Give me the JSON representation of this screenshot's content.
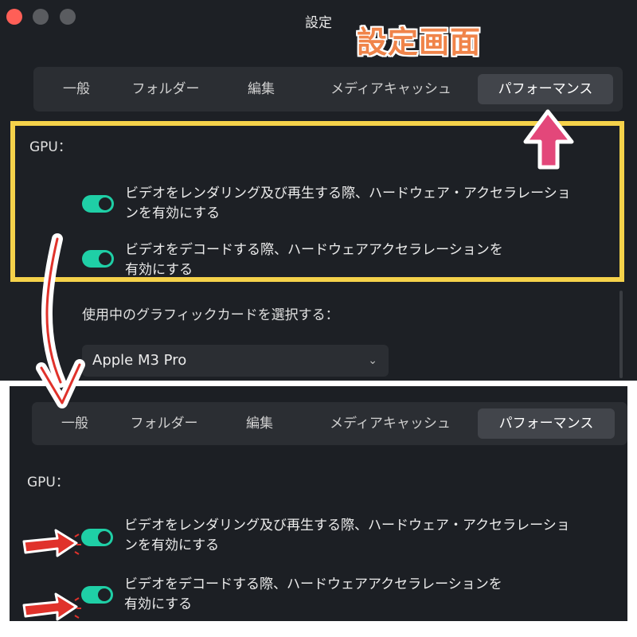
{
  "window": {
    "title": "設定"
  },
  "annotation": {
    "title": "設定画面"
  },
  "tabs": [
    "一般",
    "フォルダー",
    "編集",
    "メディアキャッシュ",
    "パフォーマンス"
  ],
  "active_tab": "パフォーマンス",
  "gpu": {
    "label": "GPU：",
    "settings": [
      {
        "line1": "ビデオをレンダリング及び再生する際、ハードウェア・アクセラレーショ",
        "line2": "ンを有効にする",
        "enabled": true
      },
      {
        "line1": "ビデオをデコードする際、ハードウェアアクセラレーションを",
        "line2": "有効にする",
        "enabled": true
      }
    ],
    "card_label": "使用中のグラフィックカードを選択する：",
    "card_value": "Apple M3 Pro"
  },
  "colors": {
    "toggle_on": "#1fcfa6",
    "highlight_border": "#f5d24a",
    "pink_arrow": "#e3477a",
    "red_arrow": "#e0322b",
    "overlay_title": "#f0844a"
  }
}
